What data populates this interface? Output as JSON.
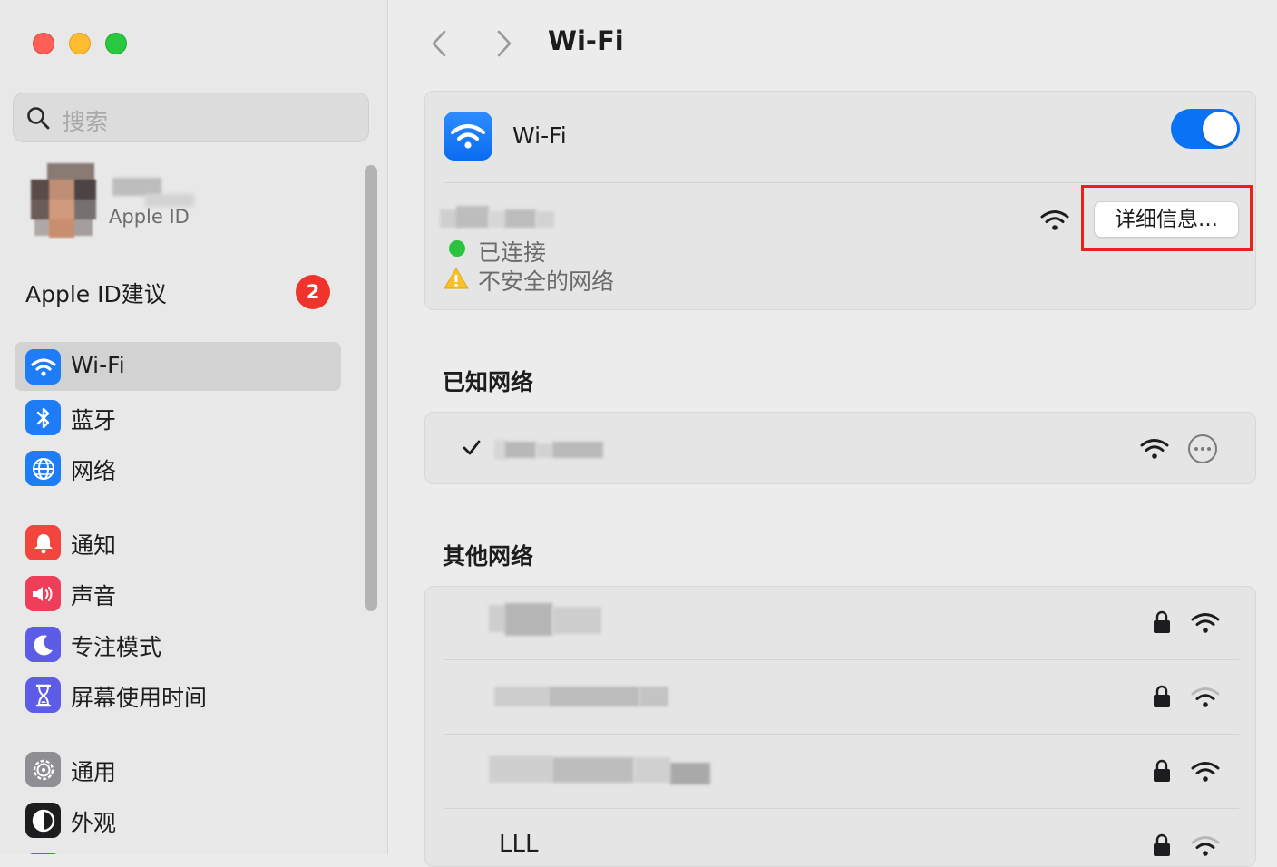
{
  "window": {
    "title": "Wi-Fi"
  },
  "sidebar": {
    "search_placeholder": "搜索",
    "account_sub": "Apple ID",
    "suggestions_label": "Apple ID建议",
    "suggestions_count": "2",
    "items": [
      {
        "label": "Wi-Fi",
        "icon": "wifi-icon",
        "color": "#1e7cf6",
        "selected": true
      },
      {
        "label": "蓝牙",
        "icon": "bluetooth-icon",
        "color": "#1e7cf6"
      },
      {
        "label": "网络",
        "icon": "globe-icon",
        "color": "#1e7cf6"
      },
      {
        "label": "通知",
        "icon": "bell-icon",
        "color": "#f2453d"
      },
      {
        "label": "声音",
        "icon": "speaker-icon",
        "color": "#ef3e5a"
      },
      {
        "label": "专注模式",
        "icon": "moon-icon",
        "color": "#5d5ce6"
      },
      {
        "label": "屏幕使用时间",
        "icon": "hourglass-icon",
        "color": "#5d5ce6"
      },
      {
        "label": "通用",
        "icon": "gear-icon",
        "color": "#8e8e93"
      },
      {
        "label": "外观",
        "icon": "appearance-icon",
        "color": "#1d1d1f"
      }
    ]
  },
  "main": {
    "title": "Wi-Fi",
    "wifi_toggle_label": "Wi-Fi",
    "wifi_enabled": true,
    "current_network": {
      "status_connected": "已连接",
      "status_warning": "不安全的网络",
      "details_button": "详细信息..."
    },
    "known_networks_title": "已知网络",
    "other_networks_title": "其他网络",
    "other_networks": [
      {
        "name": "",
        "locked": true,
        "signal": "strong"
      },
      {
        "name": "",
        "locked": true,
        "signal": "medium"
      },
      {
        "name": "",
        "locked": true,
        "signal": "strong"
      },
      {
        "name": "LLL",
        "locked": true,
        "signal": "medium"
      }
    ]
  },
  "colors": {
    "accent": "#0a72f5",
    "badge": "#f0342b",
    "connected": "#2ac23f",
    "highlight": "#e8221b"
  }
}
